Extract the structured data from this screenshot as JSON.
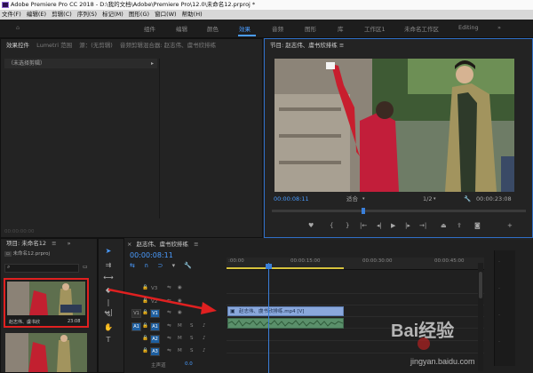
{
  "window_title": "Adobe Premiere Pro CC 2018 - D:\\我的文档\\Adobe\\Premiere Pro\\12.0\\未命名12.prproj *",
  "menu": [
    "文件(F)",
    "编辑(E)",
    "剪辑(C)",
    "序列(S)",
    "标记(M)",
    "图形(G)",
    "窗口(W)",
    "帮助(H)"
  ],
  "workspaces": [
    "组件",
    "编辑",
    "颜色",
    "效果",
    "音频",
    "图形",
    "库",
    "工作区1",
    "未命名工作区",
    "Editing"
  ],
  "active_workspace": "效果",
  "source_panel": {
    "tabs": [
      "效果控件",
      "Lumetri 范围",
      "源：(无剪辑)",
      "音频剪辑混合器: 赵志伟、虞书欣排练"
    ],
    "no_clip": "（未选择剪辑）",
    "timecode": "00:00:00:00"
  },
  "program_monitor": {
    "title": "节目: 赵志伟、虞书欣排练 ≡",
    "timecode_in": "00:00:08:11",
    "fit": "适合",
    "quality": "1/2",
    "timecode_total": "00:00:23:08",
    "progress": 0.36
  },
  "project_panel": {
    "title": "项目: 未命名12",
    "file": "未命名12.prproj",
    "search_placeholder": "",
    "items": [
      {
        "name": "赵志伟、虞书欣",
        "duration": "23:08",
        "selected": true
      },
      {
        "name": "",
        "duration": "",
        "selected": false
      }
    ]
  },
  "timeline": {
    "tab": "赵志伟、虞书欣排练",
    "timecode": "00:00:08:11",
    "ruler_labels": [
      ":00:00",
      "00:00:15:00",
      "00:00:30:00",
      "00:00:45:00"
    ],
    "video_tracks": [
      "V3",
      "V2",
      "V1"
    ],
    "audio_tracks": [
      "A1",
      "A2",
      "A3"
    ],
    "master": "主声道",
    "master_value": "0.0",
    "clip_label": "赵志伟、虞书欣排练.mp4 [V]",
    "m_label": "M",
    "s_label": "S"
  },
  "watermark": {
    "brand": "Bai经验",
    "url": "jingyan.baidu.com"
  },
  "colors": {
    "accent": "#4a9cff",
    "selection_outline": "#e02020",
    "video_clip": "#8aa8dc",
    "audio_clip": "#5a8f6a"
  }
}
